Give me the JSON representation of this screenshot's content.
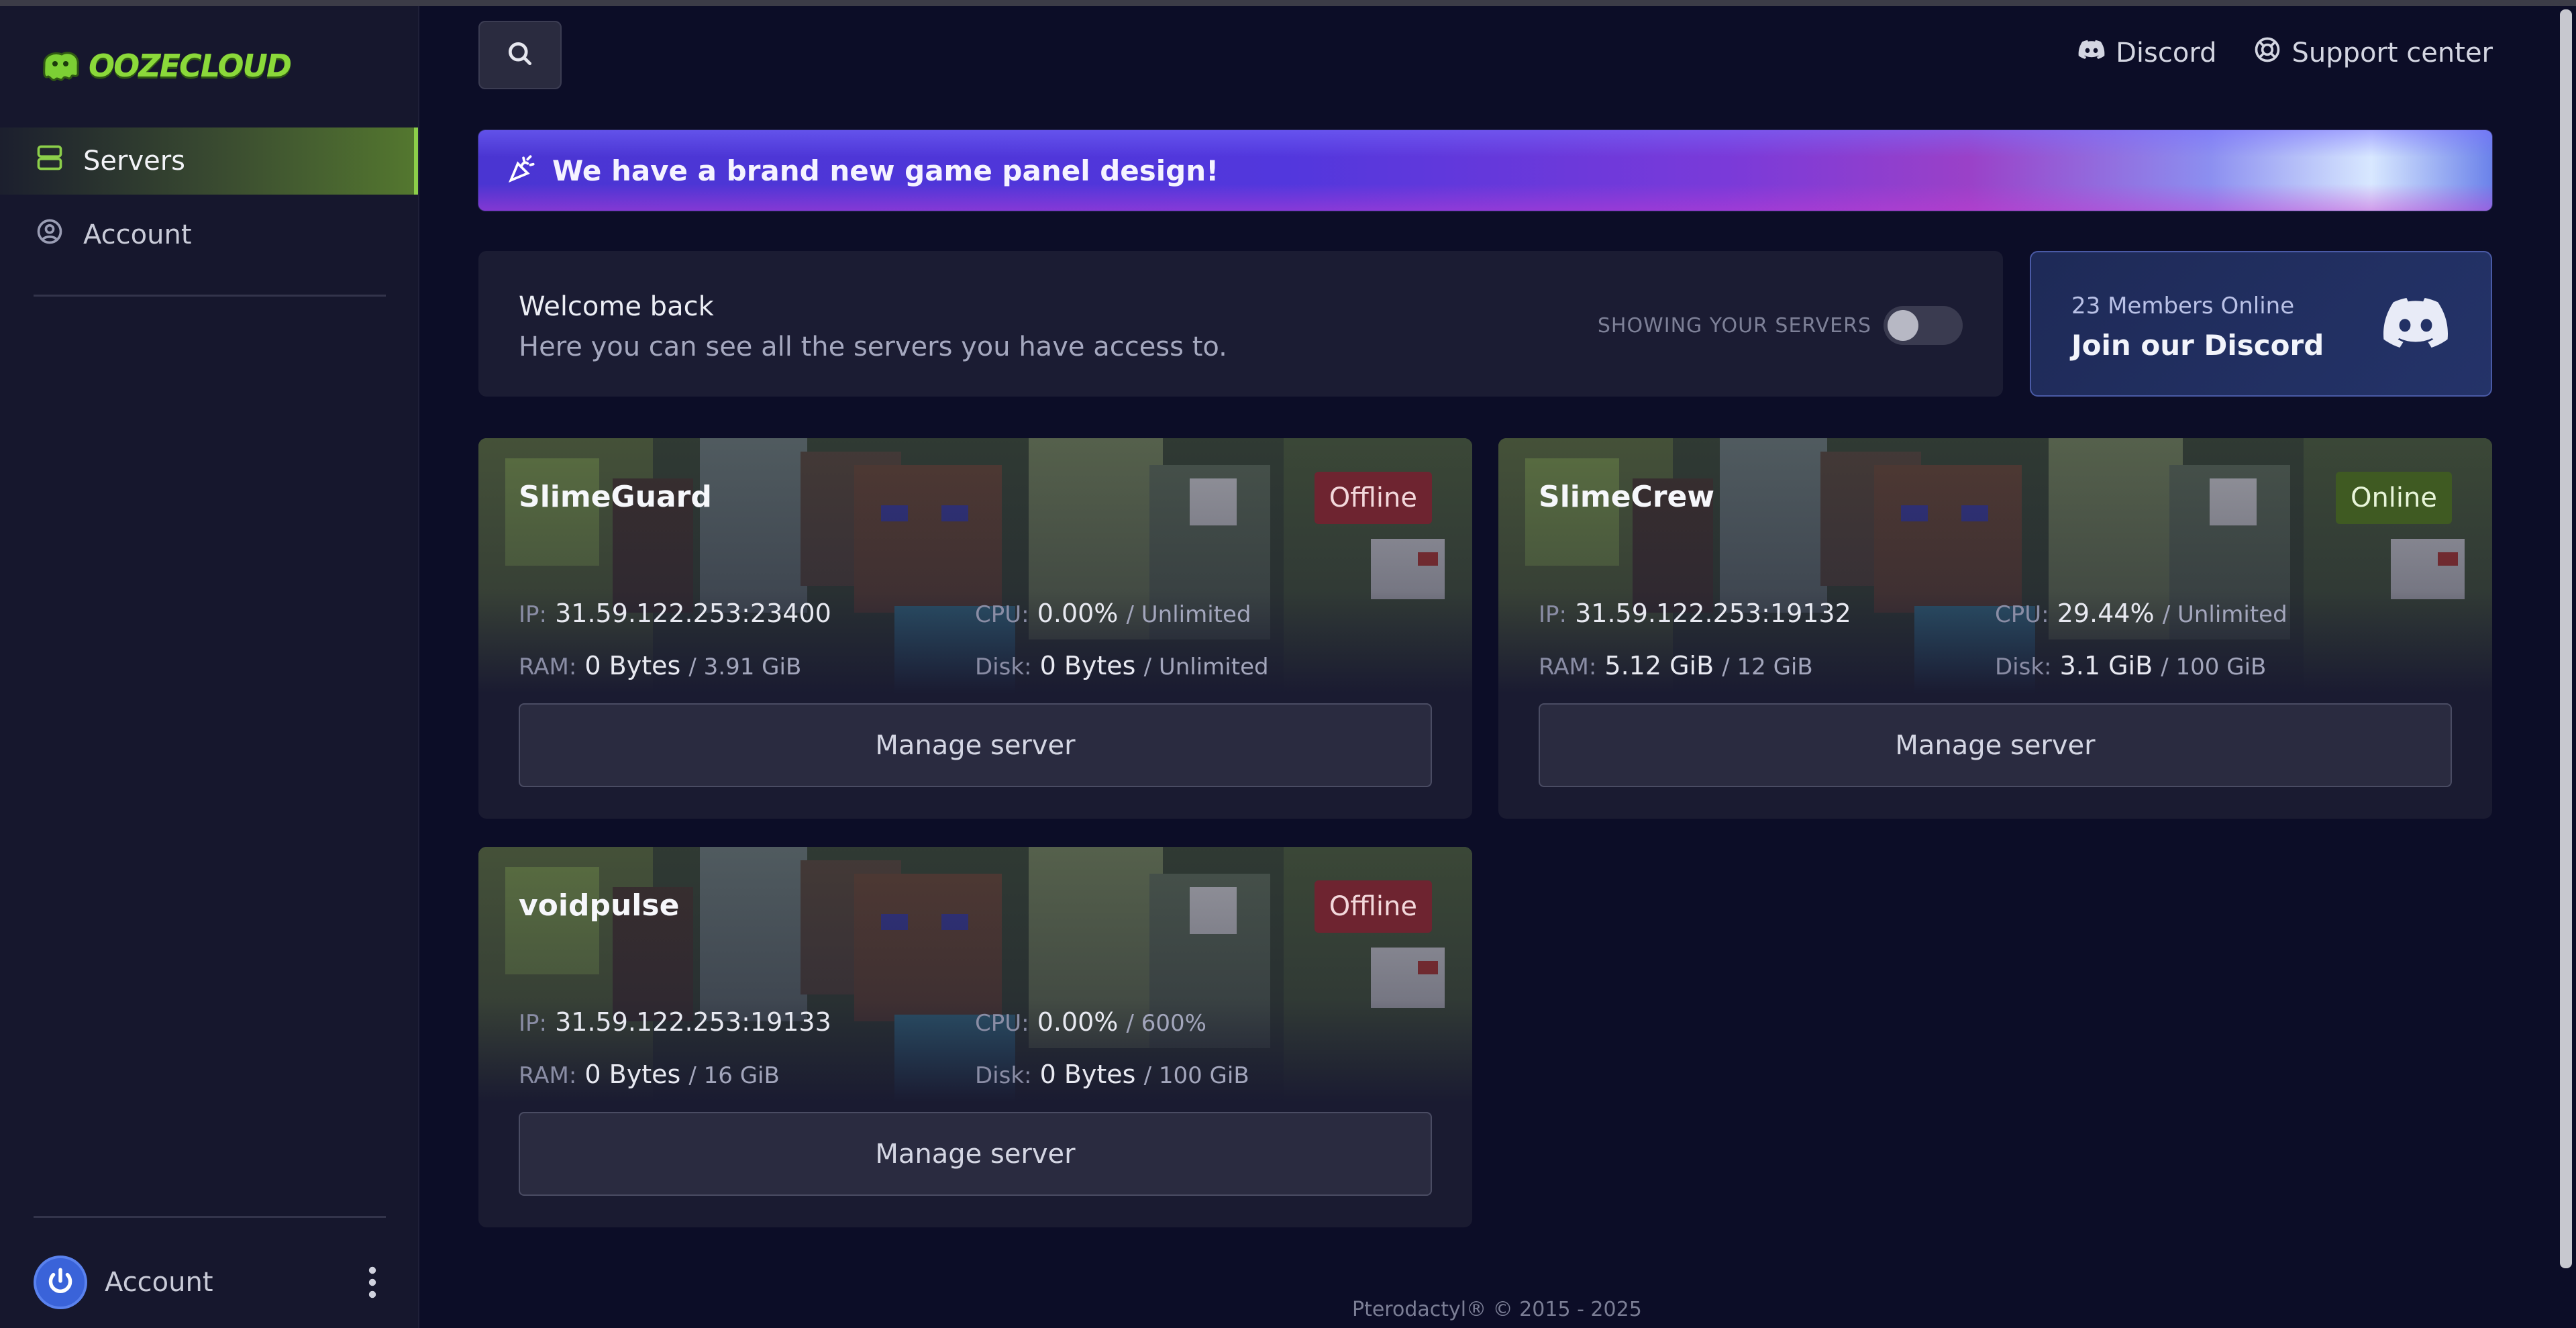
{
  "app": {
    "brand": "OOZECLOUD"
  },
  "sidebar": {
    "items": [
      {
        "label": "Servers",
        "icon": "server-icon",
        "active": true
      },
      {
        "label": "Account",
        "icon": "user-circle-icon",
        "active": false
      }
    ],
    "user_label": "Account"
  },
  "header": {
    "links": [
      {
        "label": "Discord",
        "icon": "discord-icon"
      },
      {
        "label": "Support center",
        "icon": "lifebuoy-icon"
      }
    ]
  },
  "banner": {
    "text": "We have a brand new game panel design!"
  },
  "welcome": {
    "title": "Welcome back",
    "subtitle": "Here you can see all the servers you have access to.",
    "toggle_label": "SHOWING YOUR SERVERS",
    "toggle_on": false
  },
  "discord_card": {
    "count": "23 Members Online",
    "cta": "Join our Discord"
  },
  "servers": [
    {
      "name": "SlimeGuard",
      "status": "Offline",
      "ip_label": "IP:",
      "ip": "31.59.122.253:23400",
      "cpu_label": "CPU:",
      "cpu": "0.00%",
      "cpu_max": "/ Unlimited",
      "ram_label": "RAM:",
      "ram": "0 Bytes",
      "ram_max": "/ 3.91 GiB",
      "disk_label": "Disk:",
      "disk": "0 Bytes",
      "disk_max": "/ Unlimited",
      "action": "Manage server"
    },
    {
      "name": "SlimeCrew",
      "status": "Online",
      "ip_label": "IP:",
      "ip": "31.59.122.253:19132",
      "cpu_label": "CPU:",
      "cpu": "29.44%",
      "cpu_max": "/ Unlimited",
      "ram_label": "RAM:",
      "ram": "5.12 GiB",
      "ram_max": "/ 12 GiB",
      "disk_label": "Disk:",
      "disk": "3.1 GiB",
      "disk_max": "/ 100 GiB",
      "action": "Manage server"
    },
    {
      "name": "voidpulse",
      "status": "Offline",
      "ip_label": "IP:",
      "ip": "31.59.122.253:19133",
      "cpu_label": "CPU:",
      "cpu": "0.00%",
      "cpu_max": "/ 600%",
      "ram_label": "RAM:",
      "ram": "0 Bytes",
      "ram_max": "/ 16 GiB",
      "disk_label": "Disk:",
      "disk": "0 Bytes",
      "disk_max": "/ 100 GiB",
      "action": "Manage server"
    }
  ],
  "footer": {
    "text": "Pterodactyl® © 2015 - 2025"
  },
  "colors": {
    "background": "#0c0d27",
    "sidebar": "#16172d",
    "accent_green": "#8ccf4a",
    "offline": "#6e2430",
    "online": "#3f5a22",
    "discord": "#4a5aa6"
  }
}
